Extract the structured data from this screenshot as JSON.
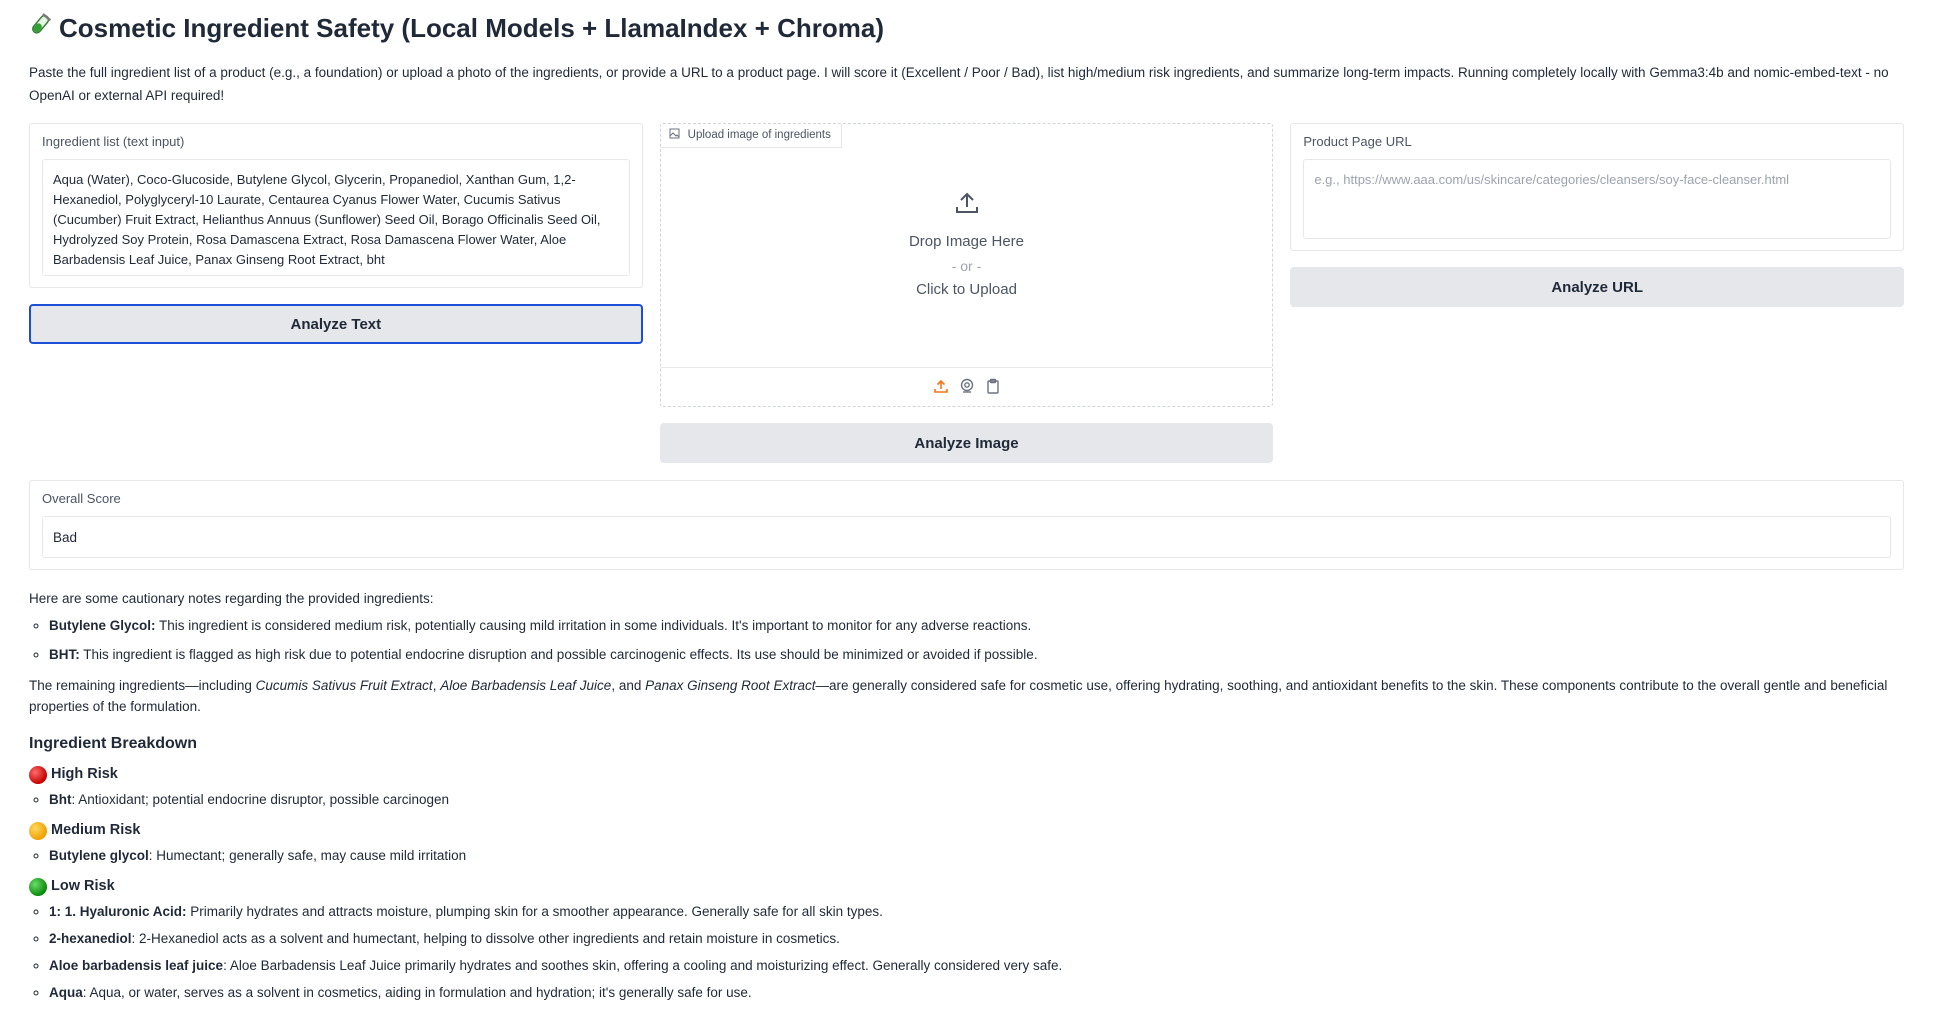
{
  "header": {
    "icon": "test-tube-icon",
    "title": "Cosmetic Ingredient Safety (Local Models + LlamaIndex + Chroma)"
  },
  "intro": "Paste the full ingredient list of a product (e.g., a foundation) or upload a photo of the ingredients, or provide a URL to a product page. I will score it (Excellent / Poor / Bad), list high/medium risk ingredients, and summarize long-term impacts. Running completely locally with Gemma3:4b and nomic-embed-text - no OpenAI or external API required!",
  "text_input": {
    "label": "Ingredient list (text input)",
    "value": "Aqua (Water), Coco-Glucoside, Butylene Glycol, Glycerin, Propanediol, Xanthan Gum, 1,2-Hexanediol, Polyglyceryl-10 Laurate, Centaurea Cyanus Flower Water, Cucumis Sativus (Cucumber) Fruit Extract, Helianthus Annuus (Sunflower) Seed Oil, Borago Officinalis Seed Oil, Hydrolyzed Soy Protein, Rosa Damascena Extract, Rosa Damascena Flower Water, Aloe Barbadensis Leaf Juice, Panax Ginseng Root Extract, bht",
    "button": "Analyze Text"
  },
  "image_input": {
    "label": "Upload image of ingredients",
    "drop_text": "Drop Image Here",
    "or_text": "- or -",
    "click_text": "Click to Upload",
    "button": "Analyze Image",
    "tools": [
      "upload-icon",
      "webcam-icon",
      "clipboard-icon"
    ]
  },
  "url_input": {
    "label": "Product Page URL",
    "placeholder": "e.g., https://www.aaa.com/us/skincare/categories/cleansers/soy-face-cleanser.html",
    "button": "Analyze URL"
  },
  "score": {
    "label": "Overall Score",
    "value": "Bad"
  },
  "analysis": {
    "intro": "Here are some cautionary notes regarding the provided ingredients:",
    "notes": [
      {
        "name": "Butylene Glycol:",
        "text": " This ingredient is considered medium risk, potentially causing mild irritation in some individuals. It's important to monitor for any adverse reactions."
      },
      {
        "name": "BHT:",
        "text": " This ingredient is flagged as high risk due to potential endocrine disruption and possible carcinogenic effects. Its use should be minimized or avoided if possible."
      }
    ],
    "summary_start": "The remaining ingredients—including ",
    "summary_i1": "Cucumis Sativus Fruit Extract",
    "summary_sep1": ", ",
    "summary_i2": "Aloe Barbadensis Leaf Juice",
    "summary_sep2": ", and ",
    "summary_i3": "Panax Ginseng Root Extract",
    "summary_end": "—are generally considered safe for cosmetic use, offering hydrating, soothing, and antioxidant benefits to the skin. These components contribute to the overall gentle and beneficial properties of the formulation."
  },
  "breakdown": {
    "title": "Ingredient Breakdown",
    "high": {
      "label": "High Risk",
      "color": "#d40000",
      "items": [
        {
          "name": "Bht",
          "text": ": Antioxidant; potential endocrine disruptor, possible carcinogen"
        }
      ]
    },
    "medium": {
      "label": "Medium Risk",
      "color": "#f5a800",
      "items": [
        {
          "name": "Butylene glycol",
          "text": ": Humectant; generally safe, may cause mild irritation"
        }
      ]
    },
    "low": {
      "label": "Low Risk",
      "color": "#12a012",
      "items": [
        {
          "name": "1: 1. Hyaluronic Acid:",
          "text": " Primarily hydrates and attracts moisture, plumping skin for a smoother appearance. Generally safe for all skin types."
        },
        {
          "name": "2-hexanediol",
          "text": ": 2-Hexanediol acts as a solvent and humectant, helping to dissolve other ingredients and retain moisture in cosmetics."
        },
        {
          "name": "Aloe barbadensis leaf juice",
          "text": ": Aloe Barbadensis Leaf Juice primarily hydrates and soothes skin, offering a cooling and moisturizing effect. Generally considered very safe."
        },
        {
          "name": "Aqua",
          "text": ": Aqua, or water, serves as a solvent in cosmetics, aiding in formulation and hydration; it's generally safe for use."
        }
      ]
    }
  }
}
